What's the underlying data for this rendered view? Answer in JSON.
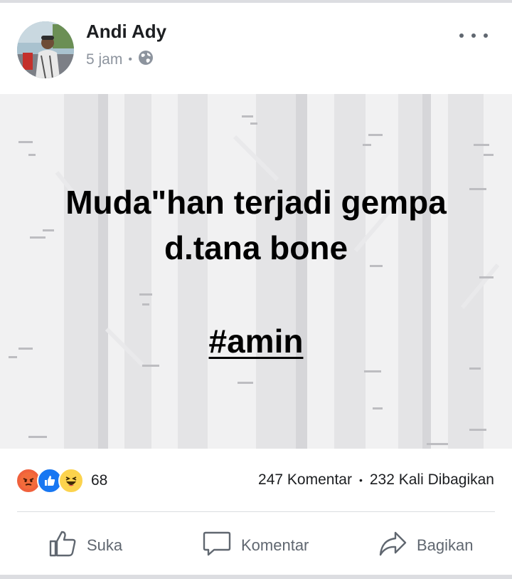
{
  "post": {
    "author": "Andi Ady",
    "time": "5 jam",
    "privacy_icon": "globe-icon",
    "more_icon": "more-horizontal-icon",
    "status_lines": [
      "Muda\"han terjadi gempa",
      "d.tana bone"
    ],
    "hashtag": "#amin",
    "background_color": "#f1f1f2"
  },
  "stats": {
    "reactions": [
      "angry",
      "like",
      "haha"
    ],
    "reaction_count": "68",
    "comments": "247 Komentar",
    "shares": "232 Kali Dibagikan"
  },
  "actions": {
    "like": "Suka",
    "comment": "Komentar",
    "share": "Bagikan"
  },
  "colors": {
    "like_blue": "#1877f2",
    "angry": "#f0613c",
    "haha": "#fcd34d",
    "muted_text": "#8d949e"
  }
}
